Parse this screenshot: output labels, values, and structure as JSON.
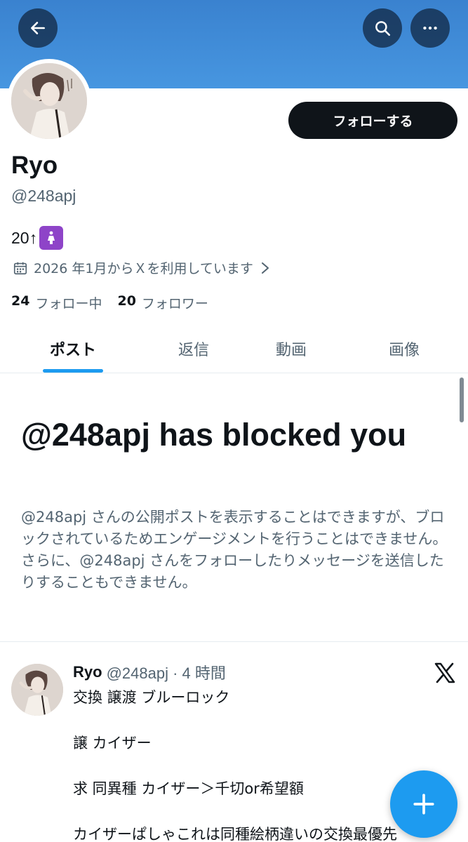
{
  "header": {
    "back_icon": "arrow-left-icon",
    "search_icon": "search-icon",
    "more_icon": "more-horizontal-icon",
    "banner_color": "#4090dc"
  },
  "profile": {
    "follow_label": "フォローする",
    "name": "Ryo",
    "handle": "@248apj",
    "bio_text": "20↑",
    "bio_emoji": "🚺",
    "joined": "2026 年1月からＸを利用しています",
    "following_count": "24",
    "following_label": "フォロー中",
    "followers_count": "20",
    "followers_label": "フォロワー"
  },
  "tabs": [
    {
      "label": "ポスト",
      "active": true
    },
    {
      "label": "返信",
      "active": false
    },
    {
      "label": "動画",
      "active": false
    },
    {
      "label": "画像",
      "active": false
    }
  ],
  "blocked": {
    "title": "@248apj has blocked you",
    "description": "@248apj さんの公開ポストを表示することはできますが、ブロックされているためエンゲージメントを行うことはできません。さらに、@248apj さんをフォローしたりメッセージを送信したりすることもできません。"
  },
  "post": {
    "name": "Ryo",
    "meta": "@248apj · 4 時間",
    "lines": [
      "交換 譲渡 ブルーロック",
      "譲 カイザー",
      "求 同異種 カイザー＞千切or希望額",
      "カイザーぱしゃこれは同種絵柄違いの交換最優先"
    ]
  },
  "fab": {
    "icon": "plus-icon",
    "color": "#1d9bf0"
  },
  "colors": {
    "primary_text": "#0f1419",
    "secondary_text": "#536471",
    "accent": "#1d9bf0"
  }
}
